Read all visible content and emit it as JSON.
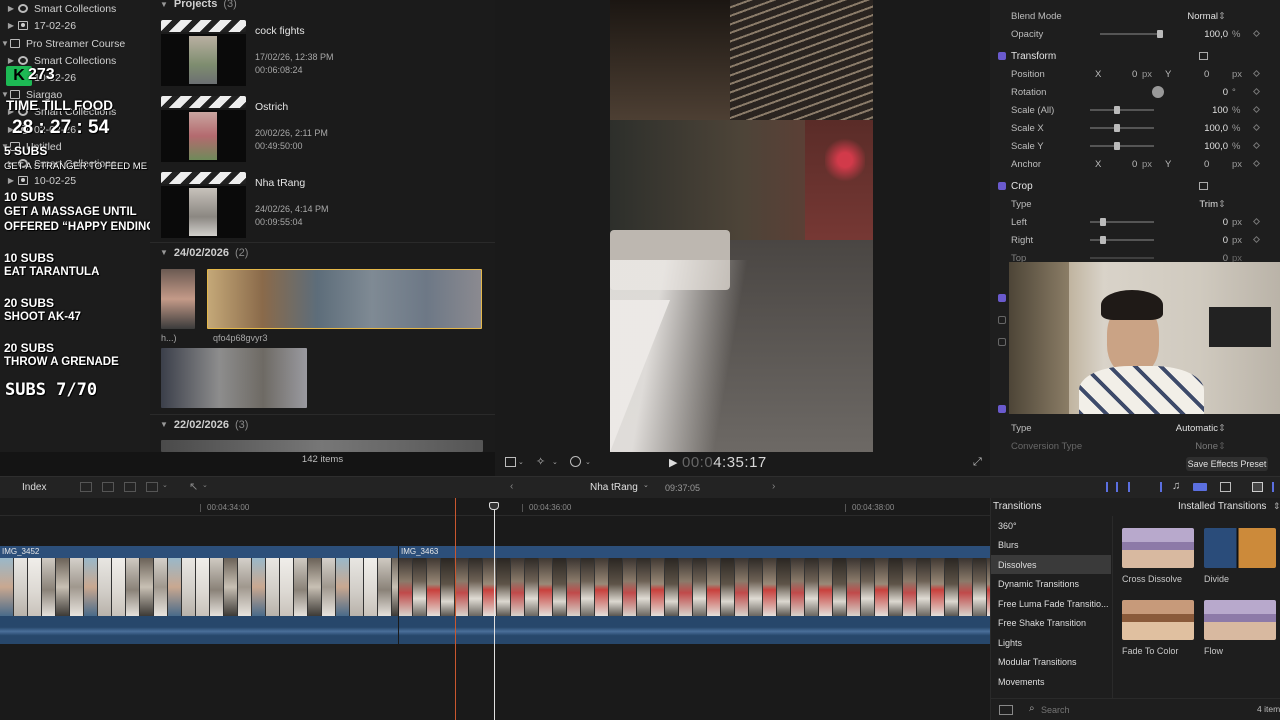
{
  "libraries": {
    "rows": [
      {
        "label": "Smart Collections",
        "icon": "gear-folder-icon",
        "indent": 1
      },
      {
        "label": "17-02-26",
        "icon": "event-icon",
        "indent": 1
      },
      {
        "label": "Pro Streamer Course",
        "icon": "library-icon",
        "indent": 0
      },
      {
        "label": "Smart Collections",
        "icon": "gear-folder-icon",
        "indent": 1
      },
      {
        "label": "10-02-26",
        "icon": "event-icon",
        "indent": 1
      },
      {
        "label": "Siargao",
        "icon": "library-icon",
        "indent": 0
      },
      {
        "label": "Smart Collections",
        "icon": "gear-folder-icon",
        "indent": 1
      },
      {
        "label": "02-02-26",
        "icon": "event-icon",
        "indent": 1
      },
      {
        "label": "Untitled",
        "icon": "library-icon",
        "indent": 0
      },
      {
        "label": "Smart Collections",
        "icon": "gear-folder-icon",
        "indent": 1
      },
      {
        "label": "10-02-25",
        "icon": "event-icon",
        "indent": 1
      }
    ]
  },
  "overlay": {
    "follower_count": "273",
    "timer_label": "TIME TILL FOOD",
    "timer_value": "28 : 27 : 54",
    "goal1_subs": "5 SUBS",
    "goal1_text": "GET A STRANGER TO FEED ME",
    "goal2_subs": "10 SUBS",
    "goal2_text1": "GET A MASSAGE UNTIL",
    "goal2_text2": "OFFERED “HAPPY ENDING”",
    "goal3_subs": "10 SUBS",
    "goal3_text": "EAT TARANTULA",
    "goal4_subs": "20 SUBS",
    "goal4_text": "SHOOT AK-47",
    "goal5_subs": "20 SUBS",
    "goal5_text": "THROW A GRENADE",
    "subs_progress": "SUBS 7/70"
  },
  "browser": {
    "projects_header": "Projects",
    "projects_count": "(3)",
    "projects": [
      {
        "name": "cock fights",
        "date": "17/02/26, 12:38 PM",
        "duration": "00:06:08:24"
      },
      {
        "name": "Ostrich",
        "date": "20/02/26, 2:11 PM",
        "duration": "00:49:50:00"
      },
      {
        "name": "Nha tRang",
        "date": "24/02/26, 4:14 PM",
        "duration": "00:09:55:04"
      }
    ],
    "event1_title": "24/02/2026",
    "event1_count": "(2)",
    "clip1_name": "h...)",
    "clip2_name": "qfo4p68gvyr3",
    "event2_title": "22/02/2026",
    "event2_count": "(3)",
    "items_count": "142 items"
  },
  "viewer": {
    "timecode_dim": "00:0",
    "timecode": "4:35:17"
  },
  "inspector": {
    "blend_mode_label": "Blend Mode",
    "blend_mode_value": "Normal",
    "opacity_label": "Opacity",
    "opacity_value": "100,0",
    "opacity_unit": "%",
    "transform_label": "Transform",
    "position_label": "Position",
    "position_x_axis": "X",
    "position_x": "0",
    "position_x_unit": "px",
    "position_y_axis": "Y",
    "position_y": "0",
    "position_y_unit": "px",
    "rotation_label": "Rotation",
    "rotation_value": "0",
    "rotation_unit": "°",
    "scale_all_label": "Scale (All)",
    "scale_all_value": "100",
    "scale_all_unit": "%",
    "scale_x_label": "Scale X",
    "scale_x_value": "100,0",
    "scale_x_unit": "%",
    "scale_y_label": "Scale Y",
    "scale_y_value": "100,0",
    "scale_y_unit": "%",
    "anchor_label": "Anchor",
    "anchor_x_axis": "X",
    "anchor_x": "0",
    "anchor_x_unit": "px",
    "anchor_y_axis": "Y",
    "anchor_y": "0",
    "anchor_y_unit": "px",
    "crop_label": "Crop",
    "crop_type_label": "Type",
    "crop_type_value": "Trim",
    "left_label": "Left",
    "left_value": "0",
    "left_unit": "px",
    "right_label": "Right",
    "right_value": "0",
    "right_unit": "px",
    "top_label": "Top",
    "top_value": "0",
    "top_unit": "px",
    "type_label": "Type",
    "type_value": "Automatic",
    "conversion_label": "Conversion Type",
    "conversion_value": "None",
    "save_preset": "Save Effects Preset"
  },
  "timeline": {
    "index_label": "Index",
    "project_name": "Nha tRang",
    "project_duration": "09:37:05",
    "ruler_labels": [
      "00:04:34:00",
      "00:04:36:00",
      "00:04:38:00"
    ],
    "clip1_name": "IMG_3452",
    "clip2_name": "IMG_3463"
  },
  "transitions": {
    "title": "Transitions",
    "installed": "Installed Transitions",
    "categories": [
      "360°",
      "Blurs",
      "Dissolves",
      "Dynamic Transitions",
      "Free Luma Fade Transitio...",
      "Free Shake Transition",
      "Lights",
      "Modular Transitions",
      "Movements"
    ],
    "selected_index": 2,
    "items": [
      "Cross Dissolve",
      "Divide",
      "Fade To Color",
      "Flow"
    ],
    "search_placeholder": "Search",
    "item_count": "4 item"
  }
}
